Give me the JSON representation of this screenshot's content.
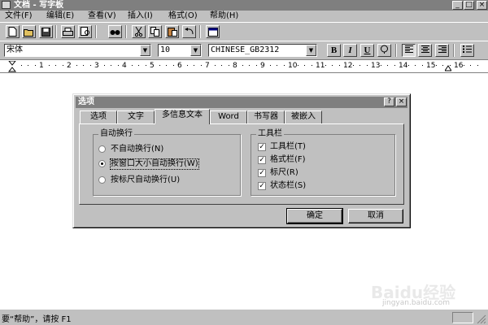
{
  "window": {
    "title": "文档 - 写字板",
    "minimize_glyph": "_",
    "maximize_glyph": "□",
    "close_glyph": "×"
  },
  "menu": [
    "文件(F)",
    "编辑(E)",
    "查看(V)",
    "插入(I)",
    "格式(O)",
    "帮助(H)"
  ],
  "toolbar": {
    "icons": [
      "new-document-icon",
      "open-folder-icon",
      "save-icon",
      "print-icon",
      "print-preview-icon",
      "find-icon",
      "cut-icon",
      "copy-icon",
      "paste-icon",
      "undo-icon",
      "insert-datetime-icon"
    ]
  },
  "format_bar": {
    "font_name": "宋体",
    "font_size": "10",
    "script": "CHINESE_GB2312",
    "bold": "B",
    "italic": "I",
    "underline": "U"
  },
  "ruler": {
    "labels": [
      "1",
      "2",
      "3",
      "4",
      "5",
      "6",
      "7",
      "8",
      "9",
      "10",
      "11",
      "12",
      "13",
      "14",
      "15",
      "16"
    ]
  },
  "dialog": {
    "title": "选项",
    "help_glyph": "?",
    "close_glyph": "×",
    "tabs": [
      "选项",
      "文字",
      "多信息文本",
      "Word",
      "书写器",
      "被嵌入"
    ],
    "active_tab": "多信息文本",
    "wrap_group": {
      "label": "自动换行",
      "options": [
        {
          "label": "不自动换行(N)",
          "selected": false
        },
        {
          "label": "按窗口大小自动换行(W)",
          "selected": true
        },
        {
          "label": "按标尺自动换行(U)",
          "selected": false
        }
      ]
    },
    "toolbar_group": {
      "label": "工具栏",
      "options": [
        {
          "label": "工具栏(T)",
          "checked": true
        },
        {
          "label": "格式栏(F)",
          "checked": true
        },
        {
          "label": "标尺(R)",
          "checked": true
        },
        {
          "label": "状态栏(S)",
          "checked": true
        }
      ]
    },
    "ok_label": "确定",
    "cancel_label": "取消"
  },
  "statusbar": {
    "text": "要“帮助”，请按 F1"
  },
  "watermark": {
    "brand": "Baidu经验",
    "url": "jingyan.baidu.com"
  }
}
